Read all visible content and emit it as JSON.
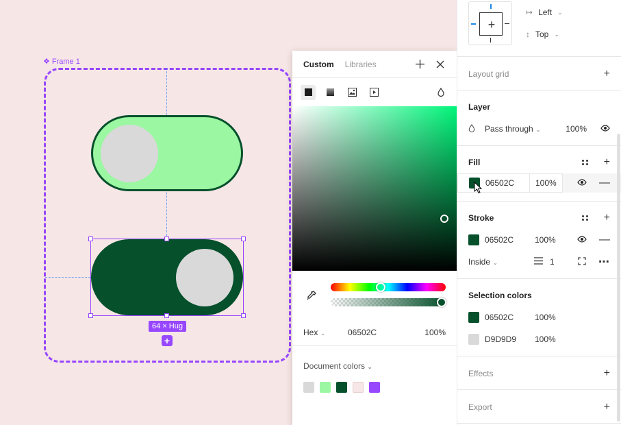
{
  "canvas": {
    "frame_label": "Frame 1",
    "size_badge": "64 × Hug",
    "add_badge": "+"
  },
  "color_popup": {
    "tabs": [
      {
        "label": "Custom",
        "active": true
      },
      {
        "label": "Libraries",
        "active": false
      }
    ],
    "hex_mode": "Hex",
    "hex_value": "06502C",
    "opacity": "100%",
    "document_colors_label": "Document colors",
    "document_colors": [
      "#D9D9D9",
      "#9BF7A1",
      "#06502C",
      "#F7E6E6",
      "#9747FF"
    ]
  },
  "panel": {
    "constraints": {
      "horizontal": "Left",
      "vertical": "Top"
    },
    "layout_grid": {
      "title": "Layout grid"
    },
    "layer": {
      "title": "Layer",
      "blend": "Pass through",
      "opacity": "100%"
    },
    "fill": {
      "title": "Fill",
      "hex": "06502C",
      "opacity": "100%",
      "color": "#06502C"
    },
    "stroke": {
      "title": "Stroke",
      "hex": "06502C",
      "opacity": "100%",
      "color": "#06502C",
      "position": "Inside",
      "weight": "1"
    },
    "selection_colors": {
      "title": "Selection colors",
      "items": [
        {
          "hex": "06502C",
          "opacity": "100%",
          "color": "#06502C"
        },
        {
          "hex": "D9D9D9",
          "opacity": "100%",
          "color": "#D9D9D9"
        }
      ]
    },
    "effects": {
      "title": "Effects"
    },
    "export": {
      "title": "Export"
    }
  },
  "colors": {
    "accent": "#9747FF",
    "toggle_off": "#9BF7A1",
    "toggle_on": "#06502C",
    "knob": "#D9D9D9",
    "canvas_bg": "#F7E6E6",
    "hue_picked": "#00F57A"
  }
}
